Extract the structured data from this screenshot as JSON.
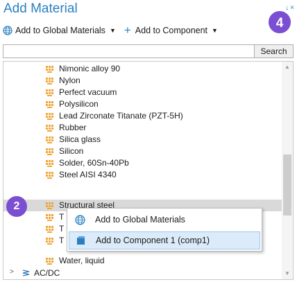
{
  "window": {
    "title": "Add Material",
    "controls": [
      "↓",
      "×"
    ]
  },
  "toolbar": {
    "add_global_label": "Add to Global Materials",
    "add_component_label": "Add to Component"
  },
  "search": {
    "value": "",
    "placeholder": "",
    "button_label": "Search"
  },
  "tree": {
    "materials": [
      {
        "label": "Nimonic alloy 90"
      },
      {
        "label": "Nylon"
      },
      {
        "label": "Perfect vacuum"
      },
      {
        "label": "Polysilicon"
      },
      {
        "label": "Lead Zirconate Titanate (PZT-5H)"
      },
      {
        "label": "Rubber"
      },
      {
        "label": "Silica glass"
      },
      {
        "label": "Silicon"
      },
      {
        "label": "Solder, 60Sn-40Pb"
      },
      {
        "label": "Steel AISI 4340"
      },
      {
        "label": "Structural steel",
        "selected": true
      },
      {
        "label": "T"
      },
      {
        "label": "T"
      },
      {
        "label": "T"
      },
      {
        "label": "Water, liquid"
      }
    ],
    "category": {
      "label": "AC/DC"
    }
  },
  "context_menu": {
    "items": [
      {
        "label": "Add to Global Materials",
        "icon": "globe-icon"
      },
      {
        "label": "Add to Component 1 (comp1)",
        "icon": "component-icon",
        "highlighted": true
      }
    ]
  },
  "badges": {
    "step_4": "4",
    "step_2": "2"
  },
  "colors": {
    "accent": "#2a7fc1",
    "badge": "#7b4fd1",
    "selection": "#d9d9d9",
    "menu_highlight": "#dcebf9",
    "material_icon": "#f0a63a"
  }
}
